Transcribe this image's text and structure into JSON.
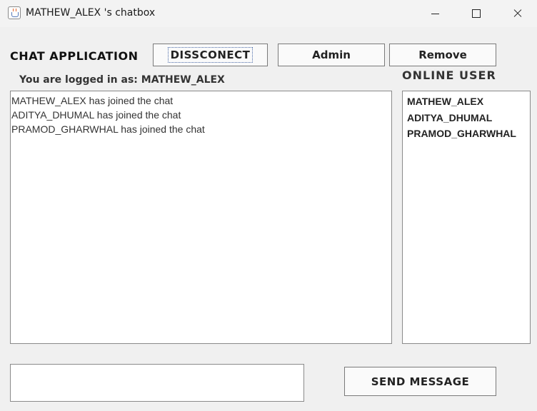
{
  "window": {
    "title": "MATHEW_ALEX 's chatbox"
  },
  "header": {
    "title": "CHAT APPLICATION",
    "disconnect_label": "DISSCONECT",
    "admin_label": "Admin",
    "remove_label": "Remove"
  },
  "status": {
    "logged_in_text": "You are logged in as: MATHEW_ALEX"
  },
  "online_users": {
    "heading": "ONLINE USER",
    "users": [
      "MATHEW_ALEX",
      "ADITYA_DHUMAL",
      "PRAMOD_GHARWHAL"
    ]
  },
  "chat": {
    "messages": [
      "MATHEW_ALEX has joined the chat",
      "ADITYA_DHUMAL has joined the chat",
      "PRAMOD_GHARWHAL has joined the chat"
    ]
  },
  "composer": {
    "value": "",
    "send_label": "SEND MESSAGE"
  }
}
